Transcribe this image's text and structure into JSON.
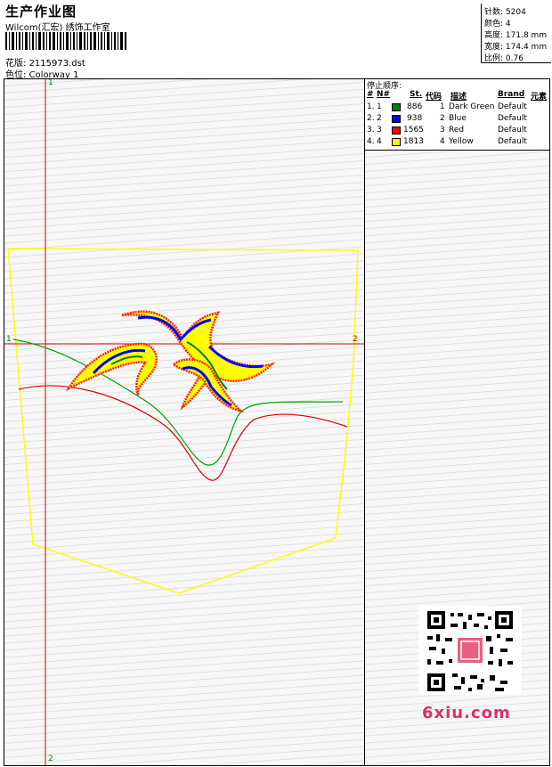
{
  "header": {
    "title": "生产作业图",
    "company": "Wilcom(汇宏) 绣饰工作室",
    "design_label": "花版:",
    "design_value": "2115973.dst",
    "colorway_label": "色位:",
    "colorway_value": "Colorway 1"
  },
  "stats": {
    "stitches_label": "针数:",
    "stitches_value": "5204",
    "colors_label": "颜色:",
    "colors_value": "4",
    "height_label": "高度:",
    "height_value": "171.8 mm",
    "width_label": "宽度:",
    "width_value": "174.4 mm",
    "scale_label": "比例:",
    "scale_value": "0.76"
  },
  "stop_sequence": {
    "title": "停止顺序:",
    "columns": [
      "#",
      "N#",
      "St.",
      "代码",
      "描述",
      "Brand",
      "元素"
    ],
    "rows": [
      {
        "idx": "1.",
        "n": "1",
        "st": "886",
        "code": "1",
        "desc": "Dark Green",
        "brand": "Default",
        "color": "#008000"
      },
      {
        "idx": "2.",
        "n": "2",
        "st": "938",
        "code": "2",
        "desc": "Blue",
        "brand": "Default",
        "color": "#0000ff"
      },
      {
        "idx": "3.",
        "n": "3",
        "st": "1565",
        "code": "3",
        "desc": "Red",
        "brand": "Default",
        "color": "#ff0000"
      },
      {
        "idx": "4.",
        "n": "4",
        "st": "1813",
        "code": "4",
        "desc": "Yellow",
        "brand": "Default",
        "color": "#ffff00"
      }
    ]
  },
  "guides": {
    "v_top": "1",
    "v_bottom": "2",
    "h_left": "1",
    "h_right": "2"
  },
  "watermark": {
    "text": "6xiu.com"
  }
}
